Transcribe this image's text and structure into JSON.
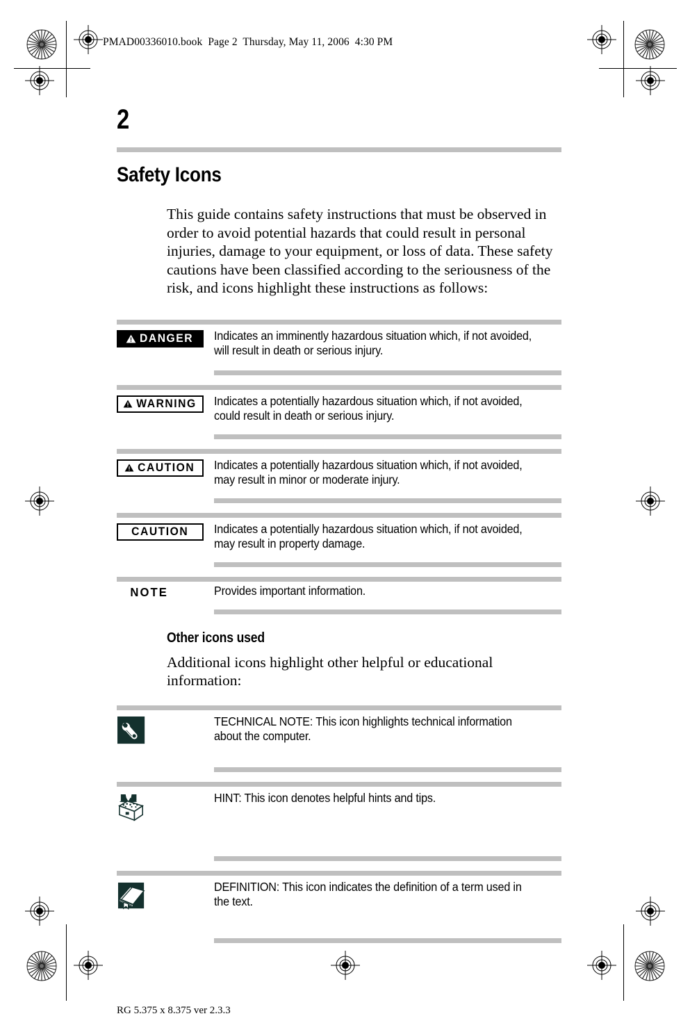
{
  "header": {
    "book_line": "PMAD00336010.book  Page 2  Thursday, May 11, 2006  4:30 PM"
  },
  "page_number": "2",
  "section": {
    "title": "Safety Icons",
    "intro": "This guide contains safety instructions that must be observed in order to avoid potential hazards that could result in personal injuries, damage to your equipment, or loss of data. These safety cautions have been classified according to the seriousness of the risk, and icons highlight these instructions as follows:"
  },
  "safety_items": [
    {
      "label": "DANGER",
      "style": "solid",
      "triangle": true,
      "description": "Indicates an imminently hazardous situation which, if not avoided, will result in death or serious injury."
    },
    {
      "label": "WARNING",
      "style": "outline",
      "triangle": true,
      "description": "Indicates a potentially hazardous situation which, if not avoided, could result in death or serious injury."
    },
    {
      "label": "CAUTION",
      "style": "outline",
      "triangle": true,
      "description": "Indicates a potentially hazardous situation which, if not avoided, may result in minor or moderate injury."
    },
    {
      "label": "CAUTION",
      "style": "outline",
      "triangle": false,
      "description": "Indicates a potentially hazardous situation which, if not avoided, may result in property damage."
    },
    {
      "label": "NOTE",
      "style": "plain",
      "triangle": false,
      "description": "Provides important information."
    }
  ],
  "other_icons": {
    "title": "Other icons used",
    "intro": "Additional icons highlight other helpful or educational information:",
    "items": [
      {
        "icon": "wrench-icon",
        "description": "TECHNICAL NOTE: This icon highlights technical information about the computer."
      },
      {
        "icon": "treasure-chest-icon",
        "description": "HINT: This icon denotes helpful hints and tips."
      },
      {
        "icon": "book-icon",
        "description": "DEFINITION: This icon indicates the definition of a term used in the text."
      }
    ]
  },
  "footer": {
    "text": "RG 5.375 x 8.375 ver 2.3.3"
  },
  "colors": {
    "rule_gray": "#bfbfbf",
    "icon_dark": "#14312e",
    "ink": "#000000"
  }
}
